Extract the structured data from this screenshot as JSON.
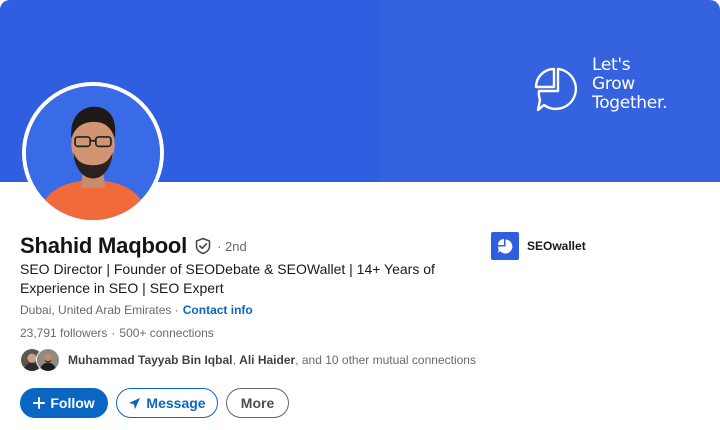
{
  "banner": {
    "slogan_line1": "Let's",
    "slogan_line2": "Grow",
    "slogan_line3": "Together.",
    "color": "#3563e0"
  },
  "profile": {
    "name": "Shahid Maqbool",
    "verified_icon": "shield-check-icon",
    "degree": "· 2nd",
    "headline": "SEO Director | Founder of SEODebate & SEOWallet | 14+ Years of Experience in SEO | SEO Expert",
    "location": "Dubai, United Arab Emirates ·",
    "contact_label": "Contact info",
    "followers": "23,791 followers",
    "connections_sep": "·",
    "connections": "500+ connections"
  },
  "mutual": {
    "name1": "Muhammad Tayyab Bin Iqbal",
    "sep": ",",
    "name2": "Ali Haider",
    "rest": ", and 10 other mutual connections"
  },
  "company": {
    "name": "SEOwallet",
    "logo_color": "#2f5fe0"
  },
  "actions": {
    "follow_label": "Follow",
    "message_label": "Message",
    "more_label": "More"
  },
  "colors": {
    "accent": "#0a66c2"
  }
}
